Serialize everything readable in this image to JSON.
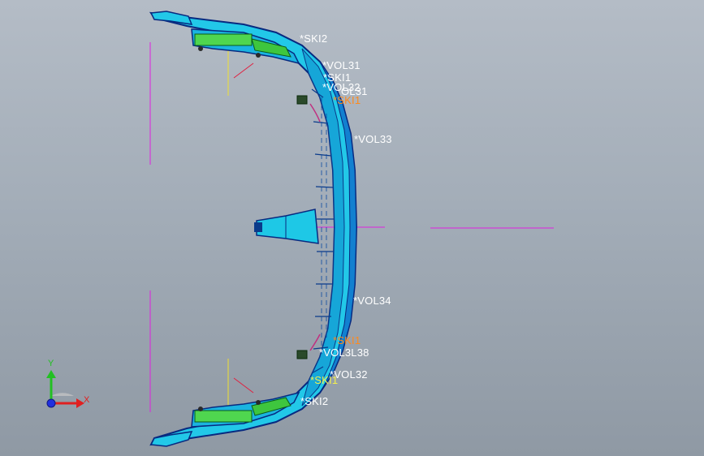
{
  "viewport": {
    "background_top": "#b4bcc6",
    "background_bottom": "#8f99a4"
  },
  "model": {
    "part_color": "#1ec8e6",
    "outline_color": "#0a3a8a",
    "rib_color": "#4fd64f"
  },
  "labels": {
    "ski2_top": "*SKI2",
    "vol31_top": "*VOL31",
    "ski1_top": "*SKI1",
    "vol32_top": "*VOL32",
    "vol31_b": "OL31",
    "ski1_orange_top": "*SKI1",
    "vol33": "*VOL33",
    "vol34": "*VOL34",
    "ski1_orange_bottom": "*SKI1",
    "vol_overlap": "*VOL3L38",
    "vol32_bottom": "*VOL32",
    "ski1_bottom": "*SKI1",
    "ski2_bottom": "*SKI2"
  },
  "triad": {
    "x_label": "X",
    "y_label": "Y",
    "x_color": "#e02020",
    "y_color": "#22c022",
    "z_color": "#2030e0"
  }
}
